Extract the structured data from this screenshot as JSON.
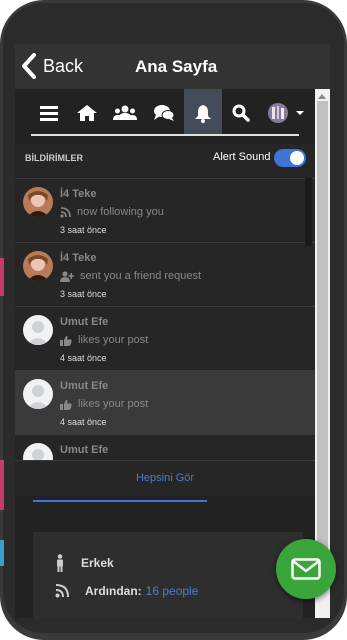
{
  "appbar": {
    "back_label": "Back",
    "title": "Ana Sayfa"
  },
  "navbar": {
    "icons": [
      "menu-icon",
      "home-icon",
      "users-icon",
      "chat-icon",
      "bell-icon",
      "search-icon",
      "profile-avatar",
      "caret-down-icon"
    ],
    "active": "bell-icon"
  },
  "notifications": {
    "title": "BİLDİRİMLER",
    "alert_sound_label": "Alert Sound",
    "alert_sound_on": true,
    "items": [
      {
        "name": "İ4 Teke",
        "action": "now following you",
        "action_icon": "rss-icon",
        "time": "3 saat önce",
        "highlighted": false
      },
      {
        "name": "İ4 Teke",
        "action": "sent you a friend request",
        "action_icon": "user-plus-icon",
        "time": "3 saat önce",
        "highlighted": false
      },
      {
        "name": "Umut Efe",
        "action": "likes your post",
        "action_icon": "thumbs-up-icon",
        "time": "4 saat önce",
        "highlighted": false
      },
      {
        "name": "Umut Efe",
        "action": "likes your post",
        "action_icon": "thumbs-up-icon",
        "time": "4 saat önce",
        "highlighted": true
      },
      {
        "name": "Umut Efe",
        "action": "",
        "action_icon": "thumbs-up-icon",
        "time": "",
        "highlighted": false
      }
    ],
    "see_all_label": "Hepsini Gör"
  },
  "profile_card": {
    "gender": "Erkek",
    "followers_label": "Ardından:",
    "followers_value": "16 people"
  },
  "colors": {
    "accent": "#3f73d6",
    "link": "#4f7cc9",
    "fab": "#3aa53a"
  }
}
